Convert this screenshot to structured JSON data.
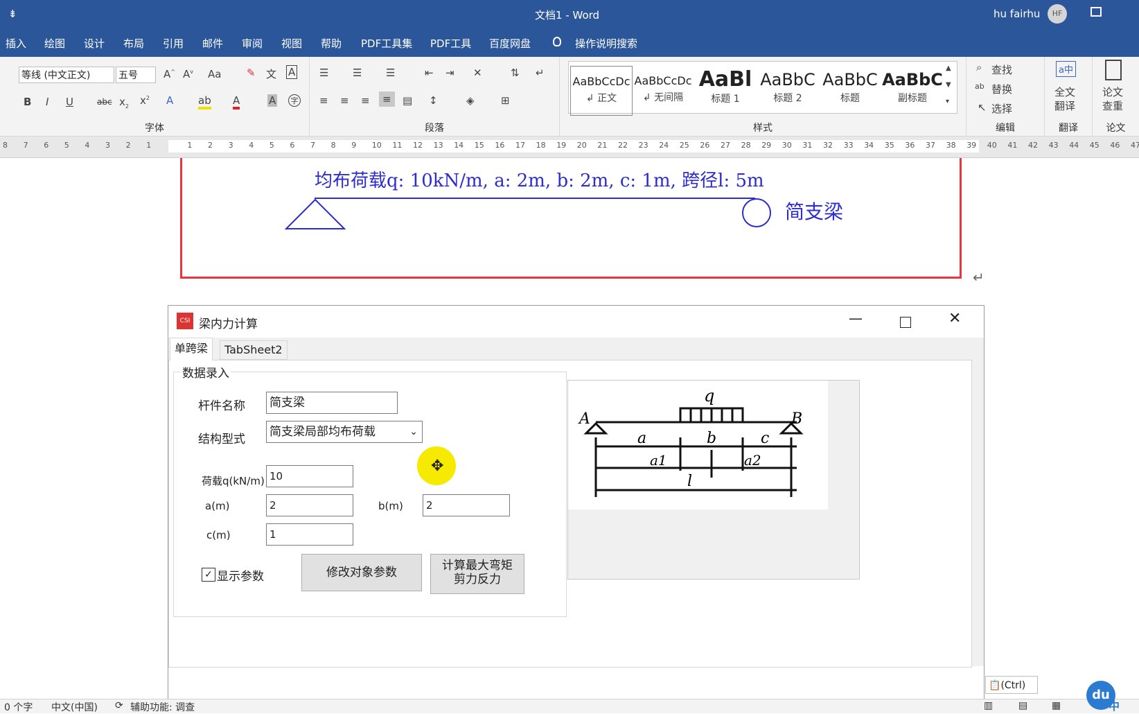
{
  "window": {
    "quick_access": "⇟",
    "title": "文档1  -  Word",
    "user": "hu fairhu",
    "avatar_initials": "HF"
  },
  "menu": [
    "插入",
    "绘图",
    "设计",
    "布局",
    "引用",
    "邮件",
    "审阅",
    "视图",
    "帮助",
    "PDF工具集",
    "PDF工具",
    "百度网盘",
    "操作说明搜索"
  ],
  "ribbon": {
    "font_name": "等线 (中文正文)",
    "font_size": "五号",
    "group_font": "字体",
    "group_paragraph": "段落",
    "group_styles": "样式",
    "group_edit": "编辑",
    "group_translate": "翻译",
    "group_paper": "论文",
    "styles": [
      {
        "preview": "AaBbCcDc",
        "name": "↲ 正文"
      },
      {
        "preview": "AaBbCcDc",
        "name": "↲ 无间隔"
      },
      {
        "preview": "AaBl",
        "name": "标题 1"
      },
      {
        "preview": "AaBbC",
        "name": "标题 2"
      },
      {
        "preview": "AaBbC",
        "name": "标题"
      },
      {
        "preview": "AaBbC",
        "name": "副标题"
      }
    ],
    "find": "查找",
    "replace": "替换",
    "select": "选择",
    "full_translate_1": "全文",
    "full_translate_2": "翻译",
    "paper_check_1": "论文",
    "paper_check_2": "查重",
    "bold": "B",
    "italic": "I",
    "underline": "U",
    "strike": "abc"
  },
  "ruler": {
    "labels": [
      "8",
      "7",
      "6",
      "5",
      "4",
      "3",
      "2",
      "1",
      "",
      "1",
      "2",
      "3",
      "4",
      "5",
      "6",
      "7",
      "8",
      "9",
      "10",
      "11",
      "12",
      "13",
      "14",
      "15",
      "16",
      "17",
      "18",
      "19",
      "20",
      "21",
      "22",
      "23",
      "24",
      "25",
      "26",
      "27",
      "28",
      "29",
      "30",
      "31",
      "32",
      "33",
      "34",
      "35",
      "36",
      "37",
      "38",
      "39",
      "40",
      "41",
      "42",
      "43",
      "44",
      "45",
      "46",
      "47"
    ]
  },
  "document": {
    "beam_text": "均布荷载q: 10kN/m, a: 2m, b: 2m, c: 1m, 跨径l: 5m",
    "beam_label": "简支梁",
    "paragraph_mark": "↵"
  },
  "dialog": {
    "title": "梁内力计算",
    "tabs": [
      "单跨梁",
      "TabSheet2"
    ],
    "group_title": "数据录入",
    "member_name_label": "杆件名称",
    "member_name_value": "简支梁",
    "struct_label": "结构型式",
    "struct_value": "简支梁局部均布荷载",
    "load_label": "荷载q(kN/m)",
    "load_value": "10",
    "a_label": "a(m)",
    "a_value": "2",
    "b_label": "b(m)",
    "b_value": "2",
    "c_label": "c(m)",
    "c_value": "1",
    "show_params_label": "显示参数",
    "show_params_checked": true,
    "modify_button": "修改对象参数",
    "calc_button_line1": "计算最大弯矩",
    "calc_button_line2": "剪力反力",
    "diagram_labels": {
      "q": "q",
      "A": "A",
      "B": "B",
      "a": "a",
      "b": "b",
      "c": "c",
      "a1": "a1",
      "a2": "a2",
      "l": "l"
    }
  },
  "paste_options": "(Ctrl)",
  "status": {
    "words": "0 个字",
    "language": "中文(中国)",
    "accessibility": "辅助功能: 调查",
    "ime": "中"
  }
}
